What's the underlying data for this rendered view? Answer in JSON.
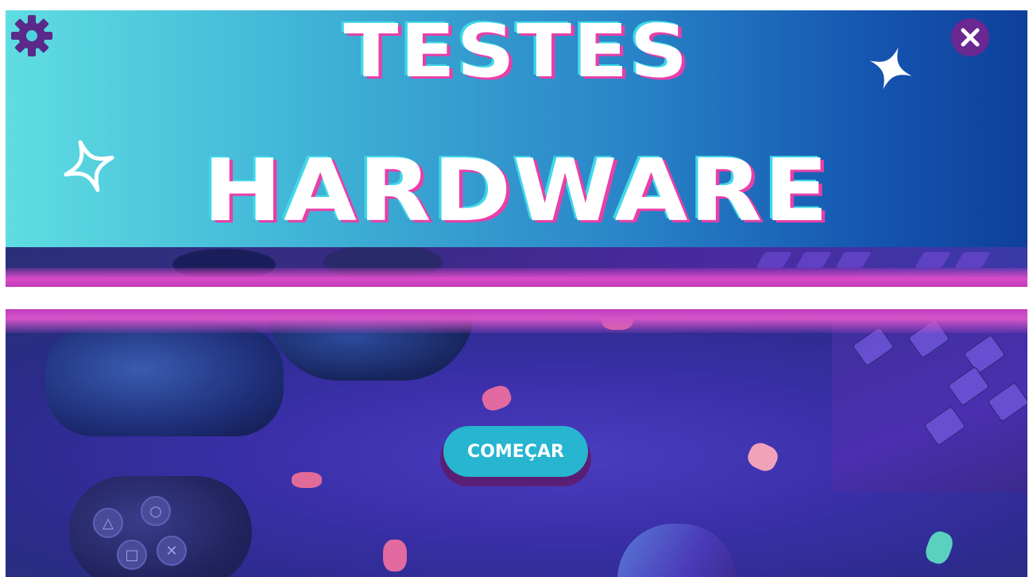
{
  "banner": {
    "title_line1": "TESTES",
    "title_line2": "HARDWARE"
  },
  "icons": {
    "settings": "gear-icon",
    "close": "close-icon",
    "sparkle_filled": "sparkle-icon",
    "sparkle_outline": "sparkle-outline-icon"
  },
  "actions": {
    "start_label": "COMEÇAR"
  },
  "colors": {
    "banner_gradient_start": "#5fdde2",
    "banner_gradient_end": "#0f3f9c",
    "accent_purple": "#6a2890",
    "button_face": "#27b5cf",
    "button_shadow": "#5a1f74",
    "glow_pink": "#d454c8"
  }
}
